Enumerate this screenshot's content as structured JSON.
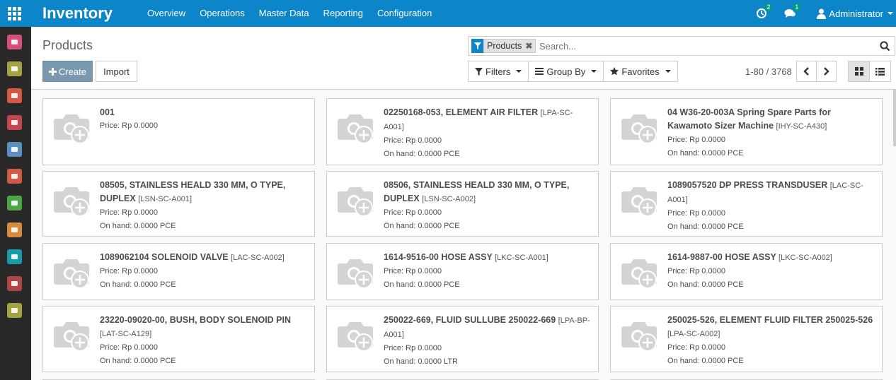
{
  "app": {
    "title": "Inventory",
    "menu": [
      "Overview",
      "Operations",
      "Master Data",
      "Reporting",
      "Configuration"
    ],
    "activity_count": "2",
    "message_count": "1",
    "user": "Administrator"
  },
  "sidebar": {
    "apps": [
      {
        "icon": "chat-icon",
        "color": "#d54f7c"
      },
      {
        "icon": "calendar-icon",
        "color": "#a3a341"
      },
      {
        "icon": "chart-icon",
        "color": "#d35945"
      },
      {
        "icon": "box-icon",
        "color": "#c5454f"
      },
      {
        "icon": "card-icon",
        "color": "#5a8fc0"
      },
      {
        "icon": "box-icon",
        "color": "#d35945"
      },
      {
        "icon": "wrench-icon",
        "color": "#4ca546"
      },
      {
        "icon": "invoice-icon",
        "color": "#d58b3b"
      },
      {
        "icon": "people-icon",
        "color": "#1b9aaa"
      },
      {
        "icon": "cubes-icon",
        "color": "#b04545"
      },
      {
        "icon": "gear-icon",
        "color": "#a3a341"
      }
    ]
  },
  "control": {
    "title": "Products",
    "create_label": "Create",
    "import_label": "Import",
    "facet": "Products",
    "search_placeholder": "Search...",
    "filters_label": "Filters",
    "groupby_label": "Group By",
    "favorites_label": "Favorites",
    "pager": "1-80 / 3768"
  },
  "products": [
    {
      "name": "001",
      "ref": "",
      "price": "Price: Rp 0.0000",
      "onhand": ""
    },
    {
      "name": "02250168-053, ELEMENT AIR FILTER",
      "ref": "[LPA-SC-A001]",
      "price": "Price: Rp 0.0000",
      "onhand": "On hand: 0.0000 PCE"
    },
    {
      "name": "04 W36-20-003A Spring Spare Parts for Kawamoto Sizer Machine",
      "ref": "[IHY-SC-A430]",
      "price": "Price: Rp 0.0000",
      "onhand": "On hand: 0.0000 PCE"
    },
    {
      "name": "08505, STAINLESS HEALD 330 MM, O TYPE, DUPLEX",
      "ref": "[LSN-SC-A001]",
      "price": "Price: Rp 0.0000",
      "onhand": "On hand: 0.0000 PCE"
    },
    {
      "name": "08506, STAINLESS HEALD 330 MM, O TYPE, DUPLEX",
      "ref": "[LSN-SC-A002]",
      "price": "Price: Rp 0.0000",
      "onhand": "On hand: 0.0000 PCE"
    },
    {
      "name": "1089057520 DP PRESS TRANSDUSER",
      "ref": "[LAC-SC-A001]",
      "price": "Price: Rp 0.0000",
      "onhand": "On hand: 0.0000 PCE"
    },
    {
      "name": "1089062104 SOLENOID VALVE",
      "ref": "[LAC-SC-A002]",
      "price": "Price: Rp 0.0000",
      "onhand": "On hand: 0.0000 PCE"
    },
    {
      "name": "1614-9516-00 HOSE ASSY",
      "ref": "[LKC-SC-A001]",
      "price": "Price: Rp 0.0000",
      "onhand": "On hand: 0.0000 PCE"
    },
    {
      "name": "1614-9887-00 HOSE ASSY",
      "ref": "[LKC-SC-A002]",
      "price": "Price: Rp 0.0000",
      "onhand": "On hand: 0.0000 PCE"
    },
    {
      "name": "23220-09020-00, BUSH, BODY SOLENOID PIN",
      "ref": "[LAT-SC-A129]",
      "price": "Price: Rp 0.0000",
      "onhand": "On hand: 0.0000 PCE"
    },
    {
      "name": "250022-669, FLUID SULLUBE 250022-669",
      "ref": "[LPA-BP-A001]",
      "price": "Price: Rp 0.0000",
      "onhand": "On hand: 0.0000 LTR"
    },
    {
      "name": "250025-526, ELEMENT FLUID FILTER 250025-526",
      "ref": "[LPA-SC-A002]",
      "price": "Price: Rp 0.0000",
      "onhand": "On hand: 0.0000 PCE"
    }
  ]
}
